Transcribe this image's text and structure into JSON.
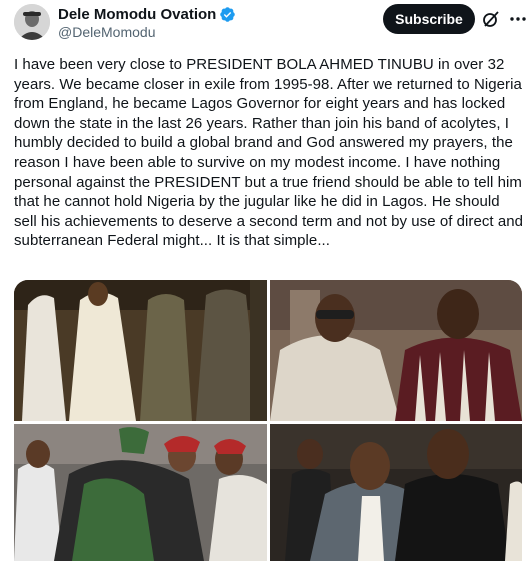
{
  "post": {
    "author_name": "Dele Momodu Ovation",
    "author_handle": "@DeleMomodu",
    "subscribe_label": "Subscribe",
    "verified_icon": "verified-badge-icon",
    "grok_icon": "grok-icon",
    "more_icon": "more-options-icon",
    "body": "I have been very close to PRESIDENT BOLA AHMED TINUBU in over 32 years. We became closer in exile from 1995-98. After we returned to Nigeria from England, he became Lagos Governor for eight years and has locked down the state in the last 26 years. Rather than join his band of acolytes, I humbly decided to build a global brand and God answered my prayers, the reason I have been able to survive on my modest income. I have nothing personal against the PRESIDENT but a true friend should be able to tell him that he cannot hold Nigeria by the jugular like he did in Lagos. He should sell his achievements to deserve a second term and not by use of direct and subterranean Federal might... It is that simple..."
  },
  "colors": {
    "text": "#0f1419",
    "secondary_text": "#536471",
    "verified_blue": "#1d9bf0",
    "subscribe_bg": "#0f1419"
  }
}
